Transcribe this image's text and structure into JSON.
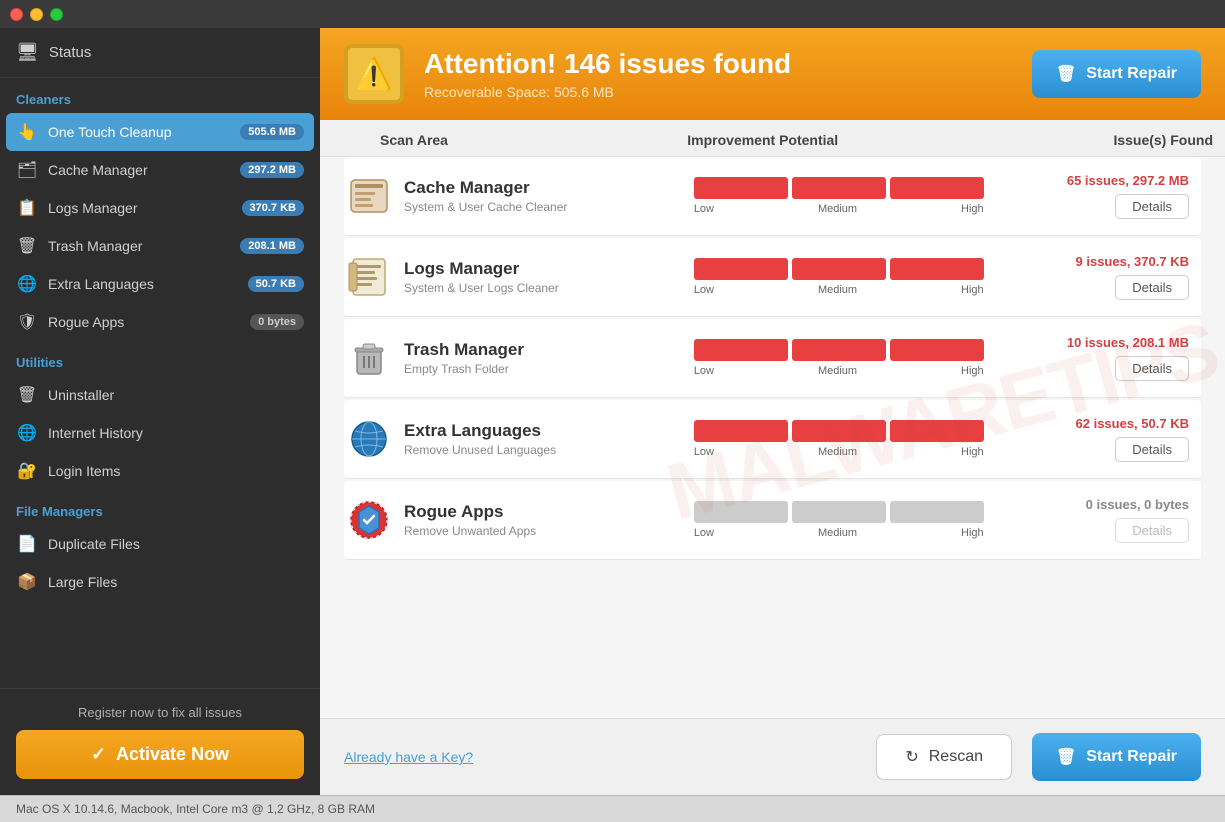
{
  "titlebar": {
    "buttons": [
      "close",
      "minimize",
      "maximize"
    ]
  },
  "sidebar": {
    "status_label": "Status",
    "sections": [
      {
        "label": "Cleaners",
        "items": [
          {
            "id": "one-touch-cleanup",
            "label": "One Touch Cleanup",
            "icon": "👆",
            "badge": "505.6 MB",
            "badge_type": "blue",
            "active": true
          },
          {
            "id": "cache-manager",
            "label": "Cache Manager",
            "icon": "🗂",
            "badge": "297.2 MB",
            "badge_type": "blue",
            "active": false
          },
          {
            "id": "logs-manager",
            "label": "Logs Manager",
            "icon": "📋",
            "badge": "370.7 KB",
            "badge_type": "blue",
            "active": false
          },
          {
            "id": "trash-manager",
            "label": "Trash Manager",
            "icon": "🗑",
            "badge": "208.1 MB",
            "badge_type": "blue",
            "active": false
          },
          {
            "id": "extra-languages",
            "label": "Extra Languages",
            "icon": "🌐",
            "badge": "50.7 KB",
            "badge_type": "blue",
            "active": false
          },
          {
            "id": "rogue-apps",
            "label": "Rogue Apps",
            "icon": "🛡",
            "badge": "0 bytes",
            "badge_type": "gray",
            "active": false
          }
        ]
      },
      {
        "label": "Utilities",
        "items": [
          {
            "id": "uninstaller",
            "label": "Uninstaller",
            "icon": "🗑",
            "badge": null,
            "active": false
          },
          {
            "id": "internet-history",
            "label": "Internet History",
            "icon": "🌐",
            "badge": null,
            "active": false
          },
          {
            "id": "login-items",
            "label": "Login Items",
            "icon": "🔐",
            "badge": null,
            "active": false
          }
        ]
      },
      {
        "label": "File Managers",
        "items": [
          {
            "id": "duplicate-files",
            "label": "Duplicate Files",
            "icon": "📄",
            "badge": null,
            "active": false
          },
          {
            "id": "large-files",
            "label": "Large Files",
            "icon": "📦",
            "badge": null,
            "active": false
          }
        ]
      }
    ],
    "register_text": "Register now to fix all issues",
    "activate_label": "Activate Now"
  },
  "alert": {
    "title": "Attention! 146 issues found",
    "subtitle": "Recoverable Space: 505.6 MB",
    "start_repair_label": "Start Repair"
  },
  "table": {
    "headers": [
      "Scan Area",
      "Improvement Potential",
      "Issue(s) Found"
    ],
    "rows": [
      {
        "id": "cache-manager-row",
        "icon": "🗂",
        "name": "Cache Manager",
        "desc": "System & User Cache Cleaner",
        "issue_count": "65 issues, 297.2 MB",
        "has_issues": true,
        "details_label": "Details"
      },
      {
        "id": "logs-manager-row",
        "icon": "📋",
        "name": "Logs Manager",
        "desc": "System & User Logs Cleaner",
        "issue_count": "9 issues, 370.7 KB",
        "has_issues": true,
        "details_label": "Details"
      },
      {
        "id": "trash-manager-row",
        "icon": "🗑",
        "name": "Trash Manager",
        "desc": "Empty Trash Folder",
        "issue_count": "10 issues, 208.1 MB",
        "has_issues": true,
        "details_label": "Details"
      },
      {
        "id": "extra-languages-row",
        "icon": "🌐",
        "name": "Extra Languages",
        "desc": "Remove Unused Languages",
        "issue_count": "62 issues, 50.7 KB",
        "has_issues": true,
        "details_label": "Details"
      },
      {
        "id": "rogue-apps-row",
        "icon": "🛡",
        "name": "Rogue Apps",
        "desc": "Remove Unwanted Apps",
        "issue_count": "0 issues, 0 bytes",
        "has_issues": false,
        "details_label": "Details"
      }
    ]
  },
  "bottom_bar": {
    "already_key_label": "Already have a Key?",
    "rescan_label": "Rescan",
    "start_repair_label": "Start Repair"
  },
  "status_bar": {
    "text": "Mac OS X 10.14.6, Macbook, Intel Core m3 @ 1,2 GHz, 8 GB RAM"
  },
  "watermark": {
    "text": "MALWARETIPS"
  }
}
